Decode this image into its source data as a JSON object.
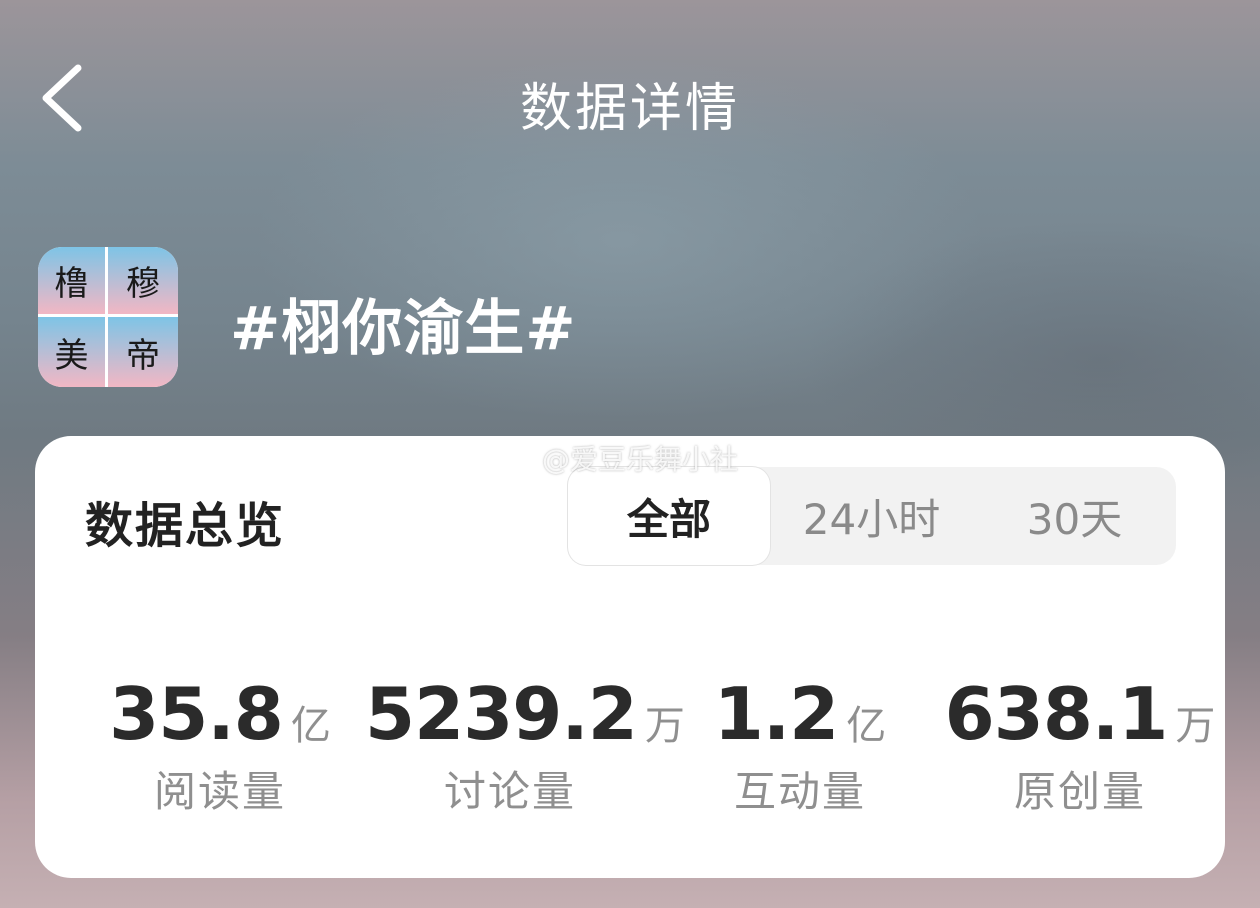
{
  "header": {
    "title": "数据详情",
    "back_icon": "chevron-left-icon"
  },
  "topic": {
    "avatar_chars": [
      "橹",
      "穆",
      "美",
      "帝"
    ],
    "title": "#栩你渝生#"
  },
  "watermark": {
    "icon": "weibo-icon",
    "text": "@爱豆乐舞小社"
  },
  "overview": {
    "title": "数据总览",
    "tabs": [
      {
        "label": "全部",
        "selected": true
      },
      {
        "label": "24小时",
        "selected": false
      },
      {
        "label": "30天",
        "selected": false
      }
    ],
    "stats": [
      {
        "value": "35.8",
        "unit": "亿",
        "label": "阅读量"
      },
      {
        "value": "5239.2",
        "unit": "万",
        "label": "讨论量"
      },
      {
        "value": "1.2",
        "unit": "亿",
        "label": "互动量"
      },
      {
        "value": "638.1",
        "unit": "万",
        "label": "原创量"
      }
    ]
  },
  "colors": {
    "card_bg": "#ffffff",
    "text_primary": "#222222",
    "text_secondary": "#8f8f8f",
    "tab_bg": "#f2f2f2"
  }
}
